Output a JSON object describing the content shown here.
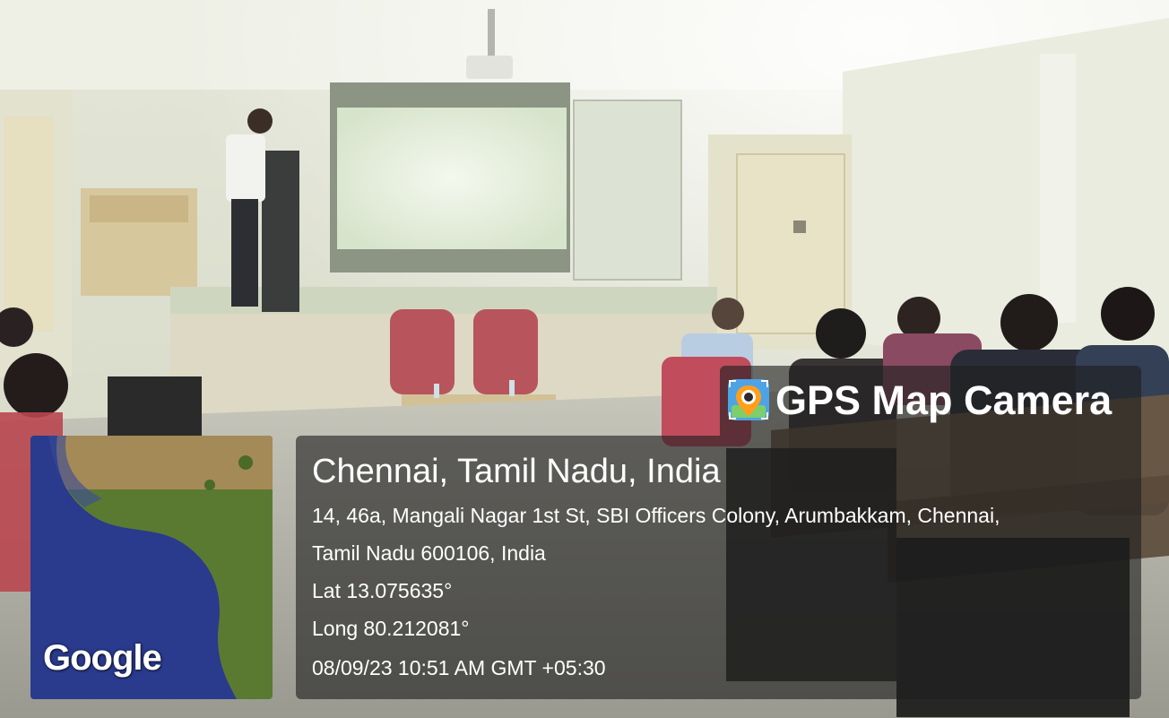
{
  "overlay": {
    "brand": {
      "icon": "map-pin-camera-icon",
      "title": "GPS Map Camera"
    },
    "location": {
      "title": "Chennai, Tamil Nadu, India",
      "address_line_1": "14, 46a, Mangali Nagar 1st St, SBI Officers Colony, Arumbakkam, Chennai,",
      "address_line_2": "Tamil Nadu 600106, India",
      "latitude": "Lat 13.075635°",
      "longitude": "Long 80.212081°",
      "timestamp": "08/09/23 10:51 AM GMT +05:30"
    },
    "map": {
      "provider_label": "Google"
    }
  },
  "colors": {
    "overlay_bg": "#1e1e1e",
    "map_water": "#2a3a8c",
    "map_land": "#5a7a32"
  }
}
